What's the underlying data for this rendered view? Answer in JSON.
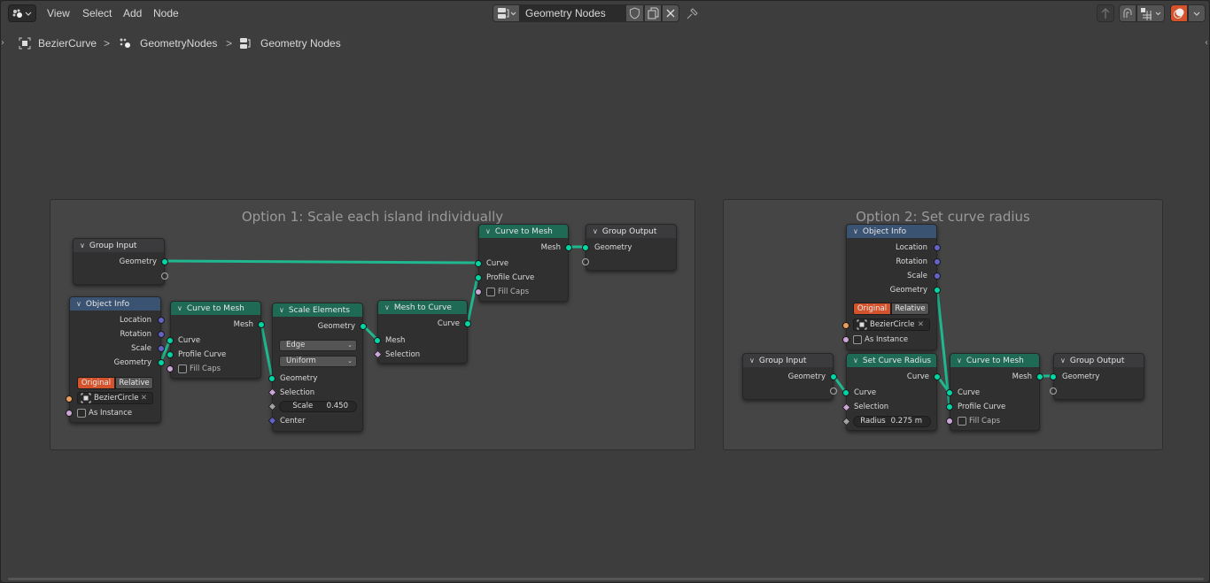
{
  "header": {
    "editor_type_icon": "geometry-nodes-icon",
    "menus": [
      "View",
      "Select",
      "Add",
      "Node"
    ],
    "node_tree_name": "Geometry Nodes",
    "fake_user_icon": "shield-icon",
    "duplicate_icon": "copy-icon",
    "unlink_icon": "close-icon",
    "pin_icon": "pin-icon",
    "right_icons": [
      "parent-up-icon",
      "snapping-magnet-icon",
      "snap-grid-icon",
      "overlays-icon"
    ]
  },
  "breadcrumb": {
    "items": [
      {
        "icon": "object-icon",
        "label": "BezierCurve"
      },
      {
        "icon": "modifier-geonodes-icon",
        "label": "GeometryNodes"
      },
      {
        "icon": "node-tree-icon",
        "label": "Geometry Nodes"
      }
    ],
    "separator": ">"
  },
  "frames": [
    {
      "title": "Option 1: Scale each island individually"
    },
    {
      "title": "Option 2: Set curve radius"
    }
  ],
  "nodes": {
    "gi1": {
      "title": "Group Input",
      "outputs": [
        "Geometry"
      ]
    },
    "oi1": {
      "title": "Object Info",
      "outputs": [
        "Location",
        "Rotation",
        "Scale",
        "Geometry"
      ],
      "toggle": [
        "Original",
        "Relative"
      ],
      "object": "BezierCircle",
      "as_instance": "As Instance"
    },
    "ctm1": {
      "title": "Curve to Mesh",
      "outputs": [
        "Mesh"
      ],
      "inputs": [
        "Curve",
        "Profile Curve",
        "Fill Caps"
      ]
    },
    "se1": {
      "title": "Scale Elements",
      "outputs": [
        "Geometry"
      ],
      "domain": "Edge",
      "mode": "Uniform",
      "inputs": [
        "Geometry",
        "Selection",
        "Center"
      ],
      "scale_label": "Scale",
      "scale_value": "0.450"
    },
    "mtc1": {
      "title": "Mesh to Curve",
      "outputs": [
        "Curve"
      ],
      "inputs": [
        "Mesh",
        "Selection"
      ]
    },
    "ctm2": {
      "title": "Curve to Mesh",
      "outputs": [
        "Mesh"
      ],
      "inputs": [
        "Curve",
        "Profile Curve",
        "Fill Caps"
      ]
    },
    "go1": {
      "title": "Group Output",
      "inputs": [
        "Geometry"
      ]
    },
    "oi2": {
      "title": "Object Info",
      "outputs": [
        "Location",
        "Rotation",
        "Scale",
        "Geometry"
      ],
      "toggle": [
        "Original",
        "Relative"
      ],
      "object": "BezierCircle",
      "as_instance": "As Instance"
    },
    "gi2": {
      "title": "Group Input",
      "outputs": [
        "Geometry"
      ]
    },
    "scr": {
      "title": "Set Curve Radius",
      "outputs": [
        "Curve"
      ],
      "inputs": [
        "Curve",
        "Selection"
      ],
      "radius_label": "Radius",
      "radius_value": "0.275 m"
    },
    "ctm3": {
      "title": "Curve to Mesh",
      "outputs": [
        "Mesh"
      ],
      "inputs": [
        "Curve",
        "Profile Curve",
        "Fill Caps"
      ]
    },
    "go2": {
      "title": "Group Output",
      "inputs": [
        "Geometry"
      ]
    }
  },
  "colors": {
    "geometry_socket": "#00d6a3",
    "vector_socket": "#6363c7",
    "boolean_socket": "#cca6d6",
    "object_socket": "#ed9e5c",
    "wire": "#1fb88f",
    "geometry_header": "#1e6a55",
    "input_header": "#3b5372",
    "toggle_active": "#d4532c"
  }
}
